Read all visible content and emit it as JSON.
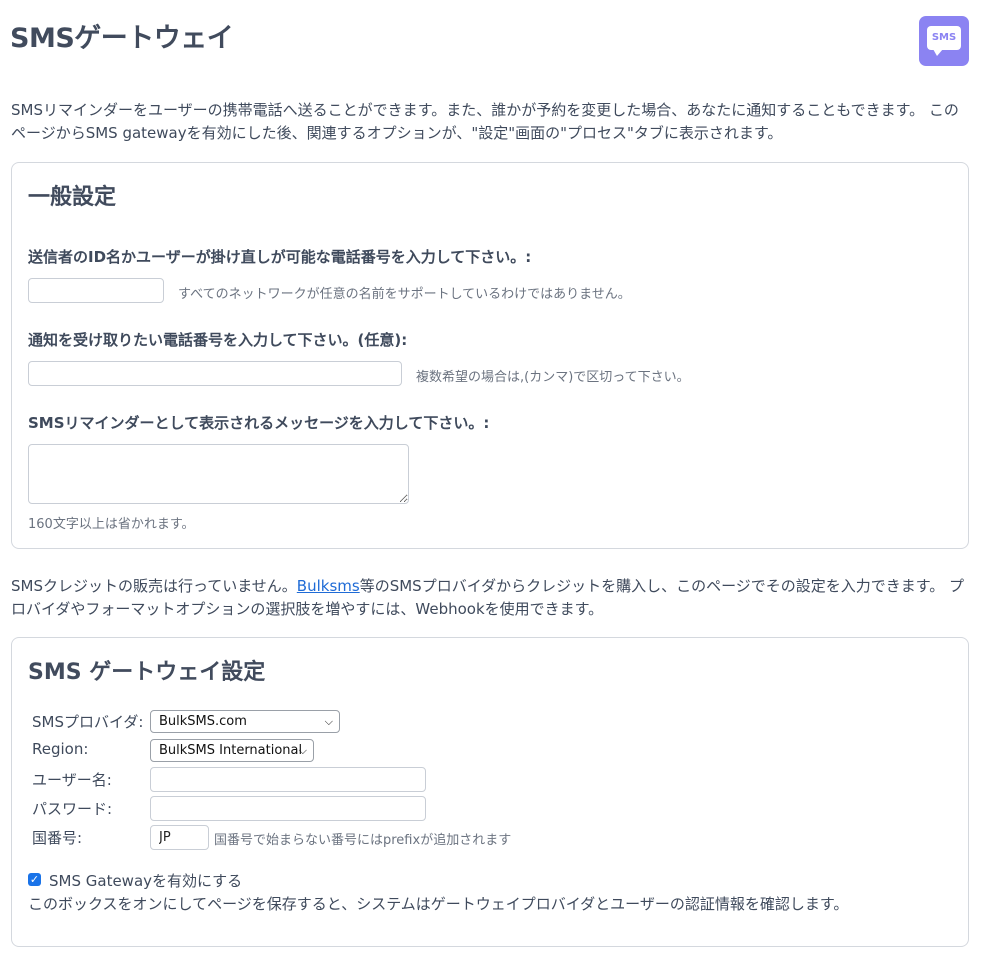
{
  "page": {
    "title": "SMSゲートウェイ",
    "badge_text": "SMS",
    "badge_icon": "sms-chat-icon",
    "accent_color": "#8b83f2",
    "intro": "SMSリマインダーをユーザーの携帯電話へ送ることができます。また、誰かが予約を変更した場合、あなたに通知することもできます。 このページからSMS gatewayを有効にした後、関連するオプションが、\"設定\"画面の\"プロセス\"タブに表示されます。"
  },
  "general": {
    "title": "一般設定",
    "sender_label": "送信者のID名かユーザーが掛け直しが可能な電話番号を入力して下さい。:",
    "sender_value": "",
    "sender_hint": "すべてのネットワークが任意の名前をサポートしているわけではありません。",
    "notify_label": "通知を受け取りたい電話番号を入力して下さい。(任意):",
    "notify_value": "",
    "notify_hint": "複数希望の場合は,(カンマ)で区切って下さい。",
    "message_label": "SMSリマインダーとして表示されるメッセージを入力して下さい。:",
    "message_value": "",
    "message_hint": "160文字以上は省かれます。"
  },
  "middle": {
    "text_before_link": "SMSクレジットの販売は行っていません。",
    "link_text": "Bulksms",
    "text_after_link": "等のSMSプロバイダからクレジットを購入し、このページでその設定を入力できます。 プロバイダやフォーマットオプションの選択肢を増やすには、Webhookを使用できます。"
  },
  "gateway": {
    "title": "SMS ゲートウェイ設定",
    "provider_label": "SMSプロバイダ:",
    "provider_value": "BulkSMS.com",
    "region_label": "Region:",
    "region_value": "BulkSMS International",
    "username_label": "ユーザー名:",
    "username_value": "",
    "password_label": "パスワード:",
    "password_value": "",
    "country_label": "国番号:",
    "country_value": "JP",
    "country_hint": "国番号で始まらない番号にはprefixが追加されます",
    "enable_label": "SMS Gatewayを有効にする",
    "enable_checked": true,
    "enable_desc": "このボックスをオンにしてページを保存すると、システムはゲートウェイプロバイダとユーザーの認証情報を確認します。"
  }
}
